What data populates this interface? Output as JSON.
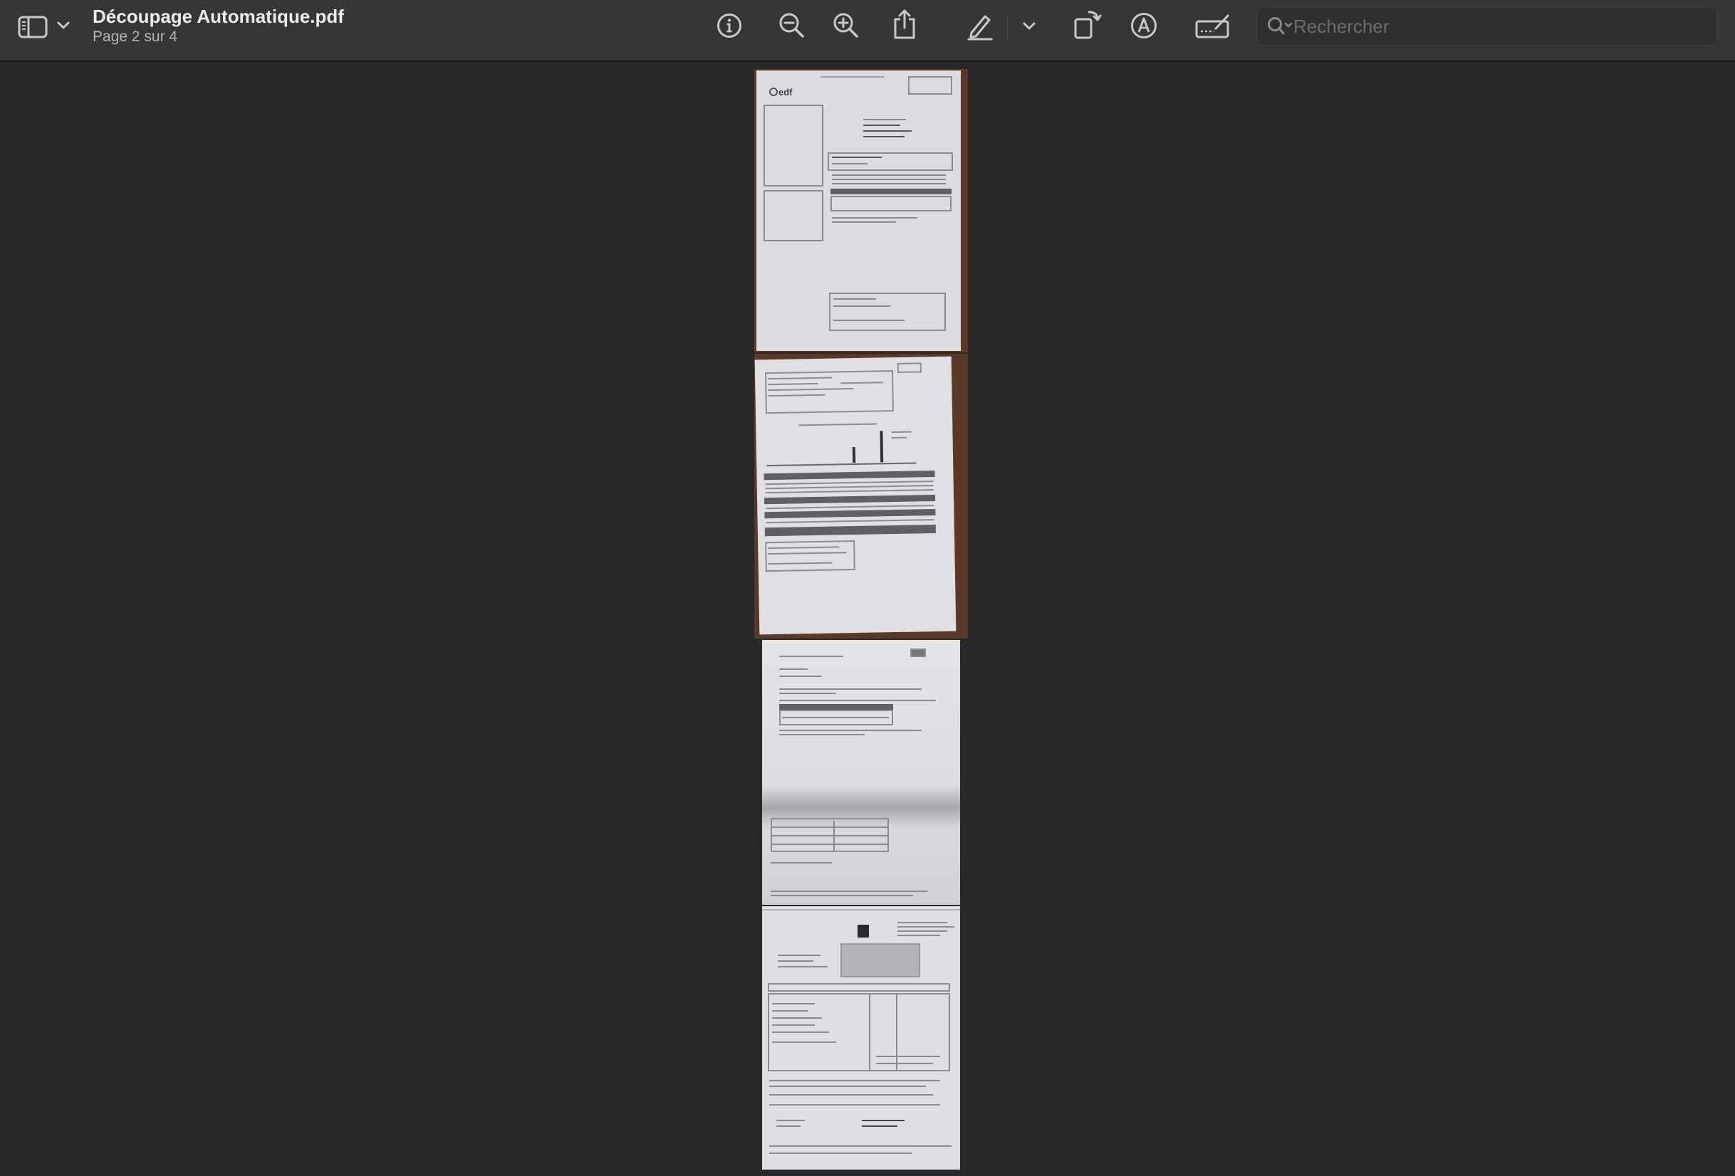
{
  "window": {
    "title": "Découpage Automatique.pdf",
    "subtitle": "Page 2 sur 4"
  },
  "toolbar": {
    "sidebar_icon": "sidebar-icon",
    "chevron_icon": "chevron-down-icon",
    "buttons": [
      "info-icon",
      "zoom-out-icon",
      "zoom-in-icon",
      "share-icon",
      "pencil-icon",
      "chevron-down-icon",
      "rotate-icon",
      "markup-icon",
      "signature-icon"
    ]
  },
  "search": {
    "placeholder": "Rechercher",
    "value": ""
  },
  "document": {
    "current_page": 2,
    "total_pages": 4
  },
  "colors": {
    "background": "#282828",
    "toolbar": "#363638",
    "paper": "#d8d8dc",
    "wood": "#5a3a26"
  }
}
